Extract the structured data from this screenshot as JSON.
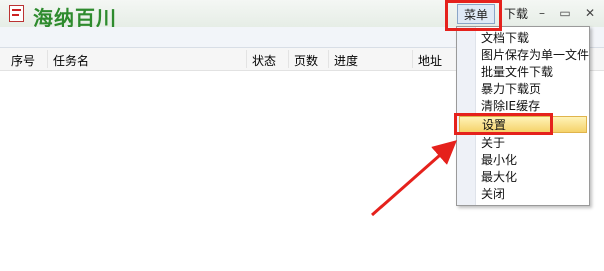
{
  "window": {
    "title": "海纳百川",
    "menu_label": "菜单",
    "download_label": "下载",
    "min_symbol": "–",
    "max_symbol": "▭",
    "close_symbol": "✕"
  },
  "table": {
    "columns": [
      "序号",
      "任务名",
      "状态",
      "页数",
      "进度",
      "地址"
    ]
  },
  "menu": {
    "items": [
      "文档下载",
      "图片保存为单一文件",
      "批量文件下载",
      "暴力下载页",
      "清除IE缓存",
      "设置",
      "关于",
      "最小化",
      "最大化",
      "关闭"
    ],
    "highlighted_index": 5
  },
  "annotations": {
    "highlight_color": "#e5211c"
  }
}
